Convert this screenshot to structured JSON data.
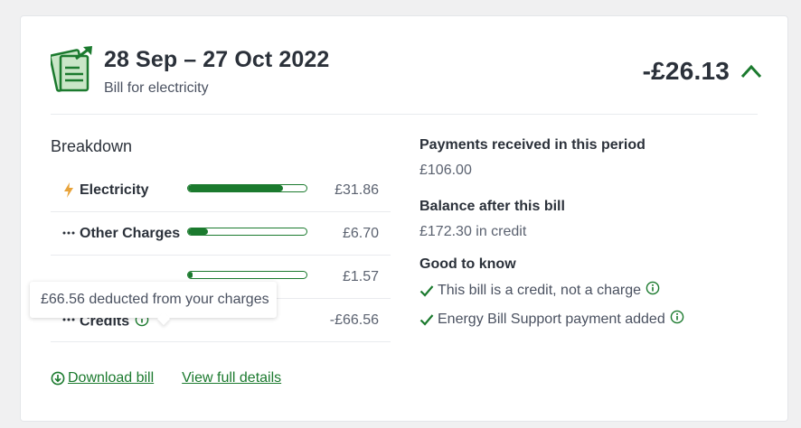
{
  "bill": {
    "period": "28 Sep – 27 Oct 2022",
    "subtitle": "Bill for electricity",
    "amount": "-£26.13",
    "icon": "bill-document-icon",
    "accent_color": "#1b7a2e"
  },
  "breakdown": {
    "heading": "Breakdown",
    "rows": [
      {
        "label": "Electricity",
        "value": "£31.86",
        "icon": "lightning-icon",
        "bar_fraction": 0.8
      },
      {
        "label": "Other Charges",
        "value": "£6.70",
        "icon": "ellipsis-icon",
        "bar_fraction": 0.17
      },
      {
        "label": "",
        "value": "£1.57",
        "icon": "",
        "bar_fraction": 0.04
      },
      {
        "label": "Credits",
        "value": "-£66.56",
        "icon": "ellipsis-icon",
        "bar_fraction": 0
      }
    ],
    "tooltip": "£66.56 deducted from your charges"
  },
  "summary": {
    "payments_heading": "Payments received in this period",
    "payments_value": "£106.00",
    "balance_heading": "Balance after this bill",
    "balance_value": "£172.30 in credit",
    "good_to_know_heading": "Good to know",
    "good_to_know_items": [
      "This bill is a credit, not a charge",
      "Energy Bill Support payment added"
    ]
  },
  "links": {
    "download": "Download bill",
    "view_details": "View full details"
  }
}
